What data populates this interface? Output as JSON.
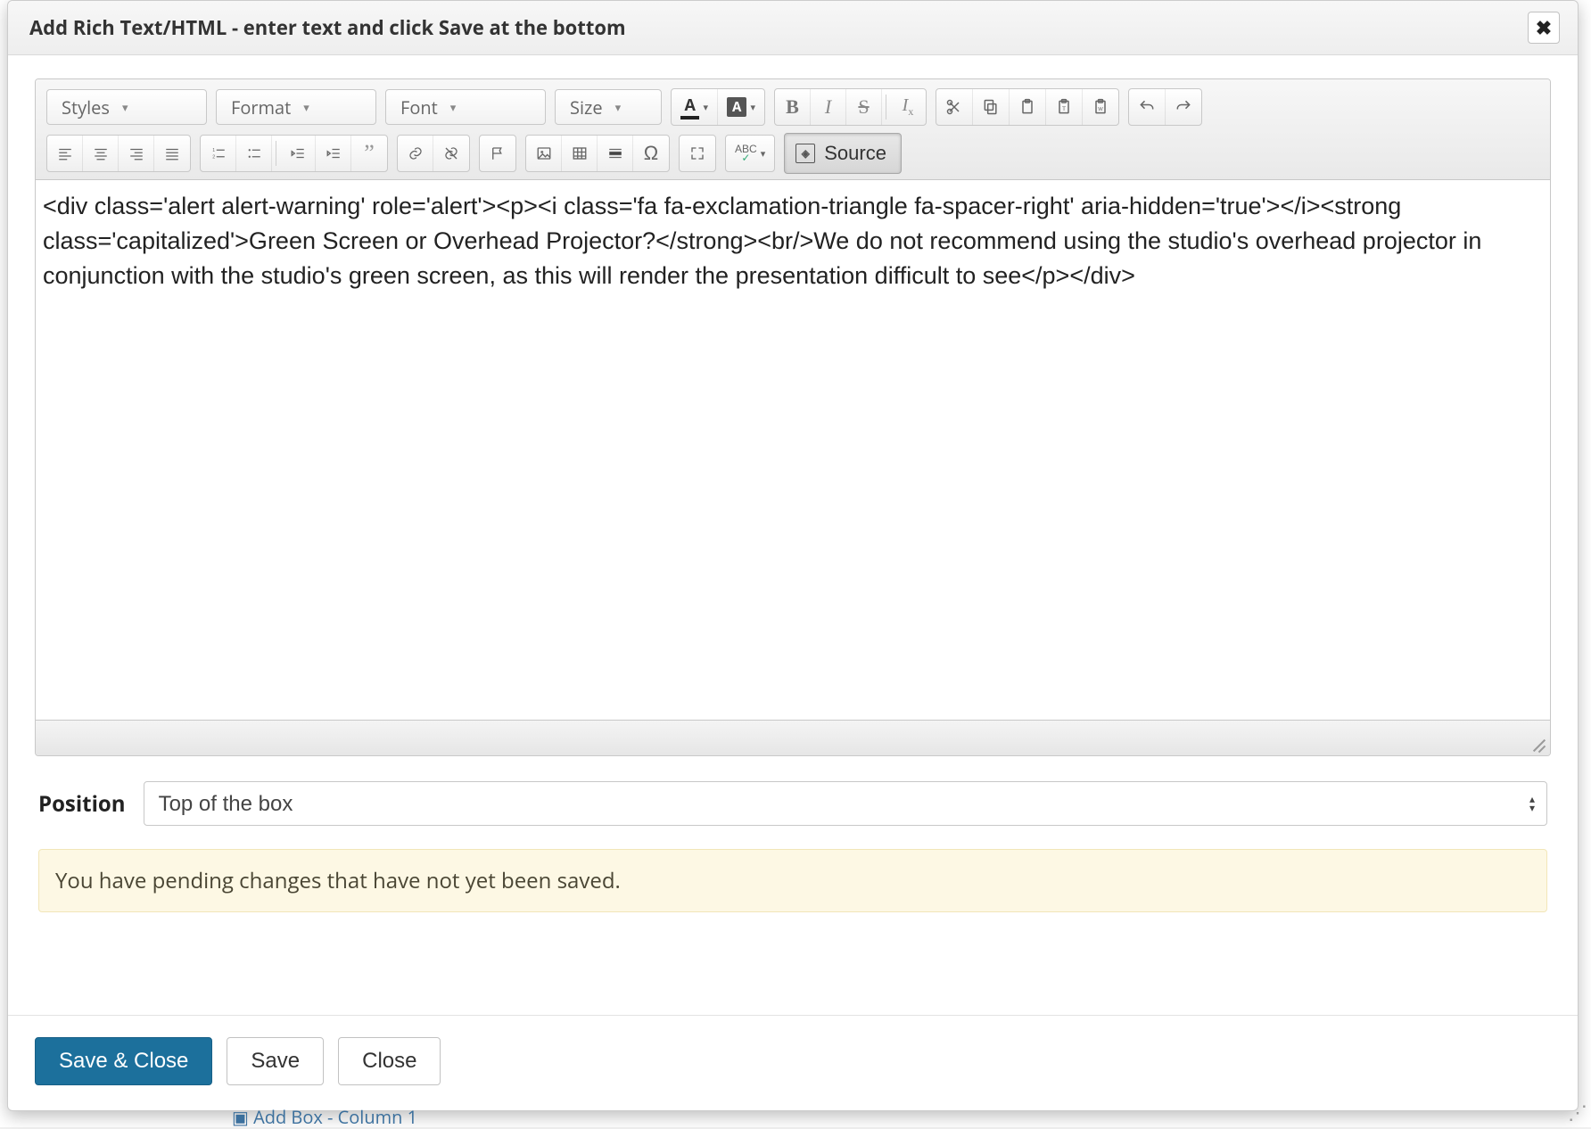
{
  "modal": {
    "title": "Add Rich Text/HTML - enter text and click Save at the bottom"
  },
  "toolbar": {
    "combos": {
      "styles": "Styles",
      "format": "Format",
      "font": "Font",
      "size": "Size"
    },
    "source_label": "Source"
  },
  "editor": {
    "content": "<div class='alert alert-warning' role='alert'><p><i class='fa fa-exclamation-triangle fa-spacer-right' aria-hidden='true'></i><strong class='capitalized'>Green Screen or Overhead Projector?</strong><br/>We do not recommend using the studio's overhead projector in conjunction with the studio's green screen, as this will render the presentation difficult to see</p></div>"
  },
  "position": {
    "label": "Position",
    "selected": "Top of the box"
  },
  "pending_message": "You have pending changes that have not yet been saved.",
  "buttons": {
    "save_close": "Save & Close",
    "save": "Save",
    "close": "Close"
  },
  "background_link": "Add Box - Column 1",
  "icons": {
    "text_color_letter": "A",
    "bg_color_letter": "A",
    "bold": "B",
    "italic": "I",
    "strike": "S"
  }
}
